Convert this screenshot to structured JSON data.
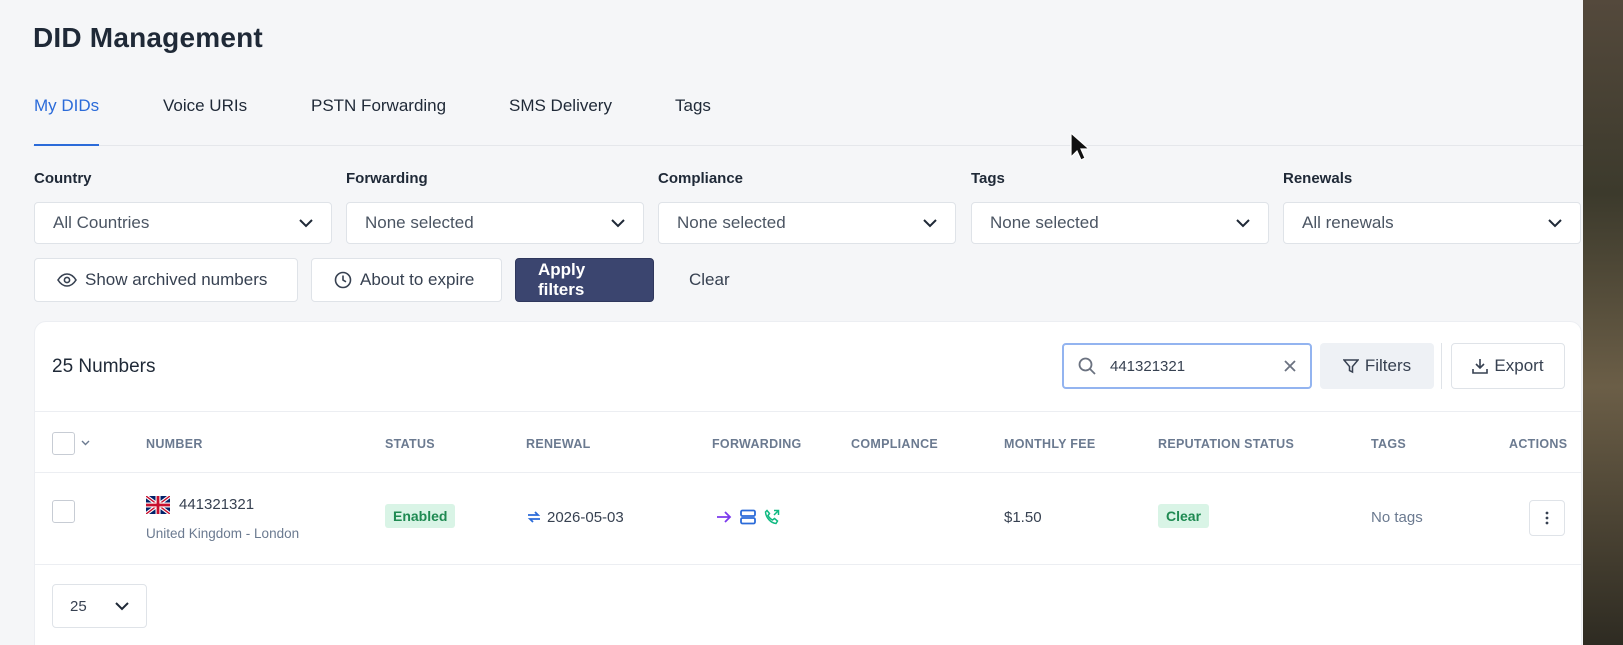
{
  "page": {
    "title": "DID Management"
  },
  "tabs": [
    {
      "label": "My DIDs",
      "active": true
    },
    {
      "label": "Voice URIs"
    },
    {
      "label": "PSTN Forwarding"
    },
    {
      "label": "SMS Delivery"
    },
    {
      "label": "Tags"
    }
  ],
  "filters": [
    {
      "label": "Country",
      "value": "All Countries"
    },
    {
      "label": "Forwarding",
      "value": "None selected"
    },
    {
      "label": "Compliance",
      "value": "None selected"
    },
    {
      "label": "Tags",
      "value": "None selected"
    },
    {
      "label": "Renewals",
      "value": "All renewals"
    }
  ],
  "buttons": {
    "show_archived": "Show archived numbers",
    "about_to_expire": "About to expire",
    "apply": "Apply filters",
    "clear": "Clear"
  },
  "table": {
    "count_label": "25 Numbers",
    "search_value": "441321321",
    "filters_label": "Filters",
    "export_label": "Export",
    "columns": [
      "NUMBER",
      "STATUS",
      "RENEWAL",
      "FORWARDING",
      "COMPLIANCE",
      "MONTHLY FEE",
      "REPUTATION STATUS",
      "TAGS",
      "ACTIONS"
    ],
    "rows": [
      {
        "number": "441321321",
        "location": "United Kingdom - London",
        "status": "Enabled",
        "renewal": "2026-05-03",
        "forwarding_icons": [
          "arrow-right-icon",
          "server-icon",
          "phone-forward-icon"
        ],
        "compliance": "",
        "monthly_fee": "$1.50",
        "reputation": "Clear",
        "tags": "No tags"
      }
    ],
    "per_page": "25"
  },
  "colors": {
    "accent": "#2b6bd9",
    "primary_button": "#3b456f",
    "badge_bg": "#d9f4e6",
    "badge_text": "#1f8a52"
  }
}
